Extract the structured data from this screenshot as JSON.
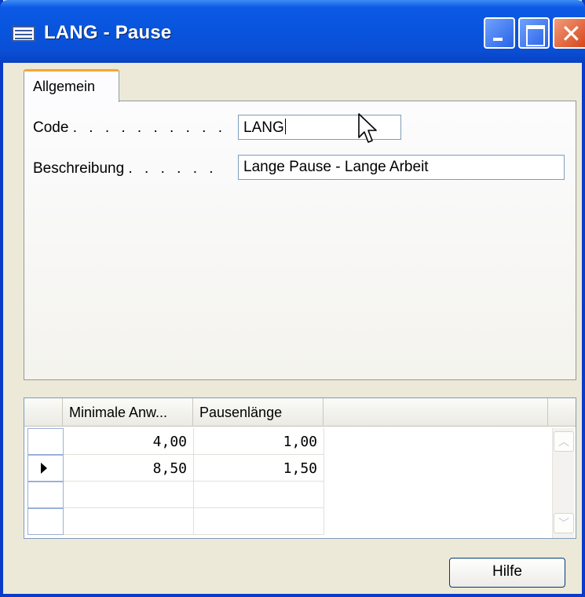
{
  "window": {
    "title": "LANG - Pause",
    "accent": "#0a4fd6"
  },
  "tabs": [
    {
      "label": "Allgemein",
      "active": true
    }
  ],
  "form": {
    "code": {
      "label": "Code",
      "dots": ". . . . . . . . . .",
      "value": "LANG"
    },
    "beschreibung": {
      "label": "Beschreibung",
      "dots": ". . . . . .",
      "value": "Lange Pause - Lange Arbeit"
    }
  },
  "grid": {
    "columns": [
      "Minimale Anw...",
      "Pausenlänge"
    ],
    "rows": [
      {
        "current": false,
        "values": [
          "4,00",
          "1,00"
        ]
      },
      {
        "current": true,
        "values": [
          "8,50",
          "1,50"
        ]
      },
      {
        "current": false,
        "values": [
          "",
          ""
        ]
      },
      {
        "current": false,
        "values": [
          "",
          ""
        ]
      }
    ]
  },
  "buttons": {
    "help_label": "Hilfe"
  }
}
